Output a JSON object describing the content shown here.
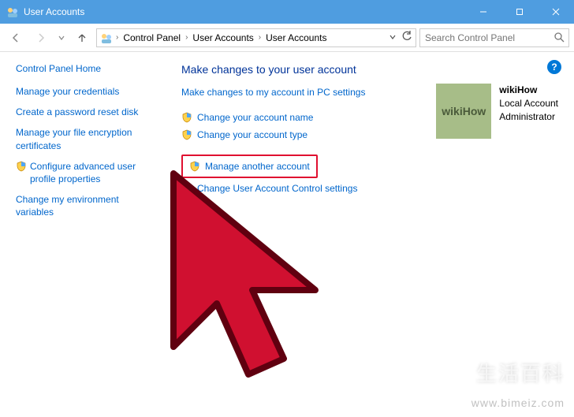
{
  "window": {
    "title": "User Accounts",
    "min": "—",
    "max": "☐",
    "close": "✕"
  },
  "breadcrumb": {
    "items": [
      "Control Panel",
      "User Accounts",
      "User Accounts"
    ]
  },
  "search": {
    "placeholder": "Search Control Panel"
  },
  "sidebar": {
    "home": "Control Panel Home",
    "links": [
      {
        "label": "Manage your credentials",
        "shield": false
      },
      {
        "label": "Create a password reset disk",
        "shield": false
      },
      {
        "label": "Manage your file encryption certificates",
        "shield": false
      },
      {
        "label": "Configure advanced user profile properties",
        "shield": true
      },
      {
        "label": "Change my environment variables",
        "shield": false
      }
    ]
  },
  "main": {
    "heading": "Make changes to your user account",
    "topLink": "Make changes to my account in PC settings",
    "options": [
      {
        "label": "Change your account name",
        "shield": true
      },
      {
        "label": "Change your account type",
        "shield": true
      }
    ],
    "highlighted": {
      "label": "Manage another account",
      "shield": true
    },
    "belowHighlight": {
      "label": "Change User Account Control settings",
      "shield": true
    }
  },
  "user": {
    "avatarText": "wikiHow",
    "name": "wikiHow",
    "type": "Local Account",
    "role": "Administrator"
  },
  "watermark": "www.bimeiz.com",
  "watermark2": "生活百科"
}
